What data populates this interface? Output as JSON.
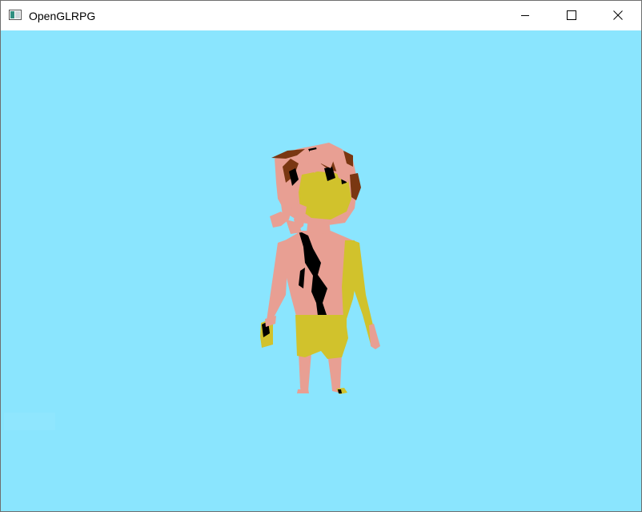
{
  "window": {
    "title": "OpenGLRPG",
    "icons": {
      "app": "app-window-icon",
      "minimize": "minimize-icon",
      "maximize": "maximize-icon",
      "close": "close-icon"
    }
  },
  "scene": {
    "background_color": "#8ae5fe",
    "character": {
      "skin_color": "#e89f93",
      "cloth_color": "#d1c22c",
      "hair_color": "#7a3712",
      "shadow_color": "#000000"
    }
  }
}
